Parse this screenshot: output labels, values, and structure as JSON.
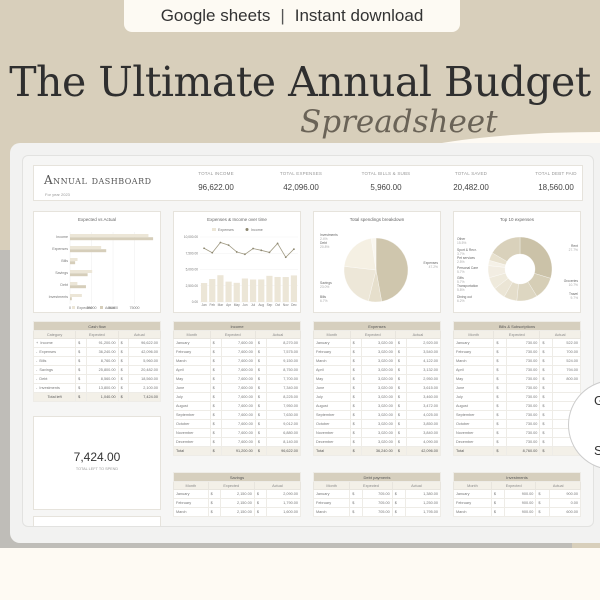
{
  "banner": {
    "left": "Google sheets",
    "separator": "|",
    "right": "Instant download"
  },
  "title": "The Ultimate Annual Budget",
  "subtitle": "Spreadsheet",
  "dashboard": {
    "title": "Annual dashboard",
    "subtitle": "For year 2023",
    "kpis": [
      {
        "label": "TOTAL INCOME",
        "value": "96,622.00"
      },
      {
        "label": "TOTAL EXPENSES",
        "value": "42,096.00"
      },
      {
        "label": "TOTAL BILLS & SUBS",
        "value": "5,960.00"
      },
      {
        "label": "TOTAL SAVED",
        "value": "20,482.00"
      },
      {
        "label": "TOTAL DEBT PAID",
        "value": "18,560.00"
      }
    ]
  },
  "chart_data": [
    {
      "type": "bar",
      "orientation": "horizontal",
      "title": "Expected vs Actual",
      "categories": [
        "Income",
        "Expenses",
        "Bills",
        "Savings",
        "Debt",
        "Investments"
      ],
      "series": [
        {
          "name": "Expected",
          "values": [
            91200,
            36240,
            8760,
            25800,
            8560,
            13800
          ],
          "color": "#ece6d7"
        },
        {
          "name": "Actual",
          "values": [
            96622,
            42096,
            5960,
            20482,
            18560,
            2100
          ],
          "color": "#d6ceba"
        }
      ],
      "xticks": [
        "0",
        "25000",
        "50000",
        "75000"
      ],
      "xlim": [
        0,
        100000
      ],
      "legend": "bottom"
    },
    {
      "type": "bar+line",
      "title": "Expenses & Income over time",
      "categories": [
        "Jan",
        "Feb",
        "Mar",
        "Apr",
        "May",
        "Jun",
        "Jul",
        "Aug",
        "Sep",
        "Oct",
        "Nov",
        "Dec"
      ],
      "series": [
        {
          "name": "Expenses",
          "type": "bar",
          "values": [
            2920,
            3540,
            4122,
            3132,
            2950,
            3615,
            3460,
            3472,
            4025,
            3850,
            3840,
            4090
          ],
          "color": "#ece6d7"
        },
        {
          "name": "Income",
          "type": "line",
          "values": [
            8270,
            7575,
            9150,
            8750,
            7700,
            7340,
            8225,
            7950,
            7630,
            9012,
            6880,
            8140
          ],
          "color": "#a09a83"
        }
      ],
      "yticks": [
        "0.00",
        "2,500.00",
        "5,000.00",
        "7,500.00",
        "10,000.00"
      ],
      "ylim": [
        0,
        10000
      ],
      "legend": "top"
    },
    {
      "type": "pie",
      "title": "Total spendings breakdown",
      "labels": [
        "Expenses",
        "Bills",
        "Savings",
        "Debt",
        "Investments"
      ],
      "values": [
        47.2,
        6.7,
        23.0,
        20.8,
        2.4
      ],
      "value_labels": [
        "47.2%",
        "6.7%",
        "23.0%",
        "20.8%",
        "2.4%"
      ],
      "colors": [
        "#cfc6ad",
        "#e6dfcc",
        "#ede7d8",
        "#f5f0e3",
        "#faf7ef"
      ]
    },
    {
      "type": "donut",
      "title": "Top 10 expenses",
      "labels": [
        "Rent",
        "Groceries",
        "Travel",
        "Dining out",
        "Transportation",
        "Gifts",
        "Personal Care",
        "Pet services",
        "Sport & Recr.",
        "Other"
      ],
      "values": [
        27.7,
        10.7,
        9.7,
        6.2,
        5.8,
        5.7,
        5.7,
        2.5,
        3.7,
        15.5
      ],
      "value_labels": [
        "27.7%",
        "10.7%",
        "9.7%",
        "6.2%",
        "5.8%",
        "5.7%",
        "5.7%",
        "2.5%",
        "3.7%",
        "15.5%"
      ],
      "colors": [
        "#cbc2a8",
        "#d6ceb6",
        "#ddd6c1",
        "#e4ddca",
        "#ebe5d5",
        "#efeadc",
        "#f2ede2",
        "#f5f1e7",
        "#e8e1ce",
        "#d9d1bb"
      ]
    }
  ],
  "cashflow": {
    "title": "Cash flow",
    "headers": [
      "Category",
      "Expected",
      "Actual"
    ],
    "rows": [
      {
        "sign": "+",
        "cat": "Income",
        "exp": "91,200.00",
        "act": "96,622.00"
      },
      {
        "sign": "-",
        "cat": "Expenses",
        "exp": "36,240.00",
        "act": "42,096.00"
      },
      {
        "sign": "-",
        "cat": "Bills",
        "exp": "8,760.00",
        "act": "5,960.00"
      },
      {
        "sign": "-",
        "cat": "Savings",
        "exp": "25,800.00",
        "act": "20,482.00"
      },
      {
        "sign": "-",
        "cat": "Debt",
        "exp": "8,560.00",
        "act": "18,560.00"
      },
      {
        "sign": "-",
        "cat": "Investments",
        "exp": "13,800.00",
        "act": "2,100.00"
      }
    ],
    "total": {
      "label": "Total left",
      "exp": "1,040.00",
      "act": "7,424.00"
    }
  },
  "currency": "$",
  "left_to_spend": {
    "value": "7,424.00",
    "label": "TOTAL LEFT TO SPEND"
  },
  "tables": [
    {
      "title": "Income",
      "headers": [
        "Month",
        "Expected",
        "Actual"
      ],
      "rows": [
        [
          "January",
          "7,600.00",
          "8,270.00"
        ],
        [
          "February",
          "7,600.00",
          "7,575.00"
        ],
        [
          "March",
          "7,600.00",
          "9,150.00"
        ],
        [
          "April",
          "7,600.00",
          "8,750.00"
        ],
        [
          "May",
          "7,600.00",
          "7,700.00"
        ],
        [
          "June",
          "7,600.00",
          "7,340.00"
        ],
        [
          "July",
          "7,600.00",
          "8,225.00"
        ],
        [
          "August",
          "7,600.00",
          "7,950.00"
        ],
        [
          "September",
          "7,600.00",
          "7,630.00"
        ],
        [
          "October",
          "7,600.00",
          "9,012.00"
        ],
        [
          "November",
          "7,600.00",
          "6,880.00"
        ],
        [
          "December",
          "7,600.00",
          "8,140.00"
        ]
      ],
      "total": [
        "Total",
        "91,200.00",
        "96,622.00"
      ]
    },
    {
      "title": "Expenses",
      "headers": [
        "Month",
        "Expected",
        "Actual"
      ],
      "rows": [
        [
          "January",
          "3,020.00",
          "2,920.00"
        ],
        [
          "February",
          "3,020.00",
          "3,540.00"
        ],
        [
          "March",
          "3,020.00",
          "4,122.00"
        ],
        [
          "April",
          "3,020.00",
          "3,132.00"
        ],
        [
          "May",
          "3,020.00",
          "2,950.00"
        ],
        [
          "June",
          "3,020.00",
          "3,615.00"
        ],
        [
          "July",
          "3,020.00",
          "3,460.00"
        ],
        [
          "August",
          "3,020.00",
          "3,472.00"
        ],
        [
          "September",
          "3,020.00",
          "4,025.00"
        ],
        [
          "October",
          "3,020.00",
          "3,850.00"
        ],
        [
          "November",
          "3,020.00",
          "3,840.00"
        ],
        [
          "December",
          "3,020.00",
          "4,090.00"
        ]
      ],
      "total": [
        "Total",
        "36,240.00",
        "42,096.00"
      ]
    },
    {
      "title": "Bills & Subscriptions",
      "headers": [
        "Month",
        "Expected",
        "Actual"
      ],
      "rows": [
        [
          "January",
          "730.00",
          "522.00"
        ],
        [
          "February",
          "730.00",
          "700.00"
        ],
        [
          "March",
          "730.00",
          "524.00"
        ],
        [
          "April",
          "730.00",
          "794.00"
        ],
        [
          "May",
          "730.00",
          "800.00"
        ],
        [
          "June",
          "730.00",
          ""
        ],
        [
          "July",
          "730.00",
          ""
        ],
        [
          "August",
          "730.00",
          ""
        ],
        [
          "September",
          "730.00",
          ""
        ],
        [
          "October",
          "730.00",
          ""
        ],
        [
          "November",
          "730.00",
          ""
        ],
        [
          "December",
          "730.00",
          ""
        ]
      ],
      "total": [
        "Total",
        "8,760.00",
        ""
      ]
    }
  ],
  "bottom_tables": [
    {
      "title": "Savings",
      "headers": [
        "Month",
        "Expected",
        "Actual"
      ],
      "rows": [
        [
          "January",
          "2,150.00",
          "2,090.00"
        ],
        [
          "February",
          "2,150.00",
          "1,790.00"
        ],
        [
          "March",
          "2,150.00",
          "1,600.00"
        ]
      ]
    },
    {
      "title": "Debt payments",
      "headers": [
        "Month",
        "Expected",
        "Actual"
      ],
      "rows": [
        [
          "January",
          "705.00",
          "1,380.00"
        ],
        [
          "February",
          "705.00",
          "1,250.00"
        ],
        [
          "March",
          "705.00",
          "1,795.00"
        ]
      ]
    },
    {
      "title": "Investments",
      "headers": [
        "Month",
        "Expected",
        "Actual"
      ],
      "rows": [
        [
          "January",
          "900.00",
          "900.00"
        ],
        [
          "February",
          "900.00",
          "0.00"
        ],
        [
          "March",
          "900.00",
          "600.00"
        ]
      ]
    }
  ],
  "circle_badge": {
    "line1": "G",
    "line2": "S"
  }
}
